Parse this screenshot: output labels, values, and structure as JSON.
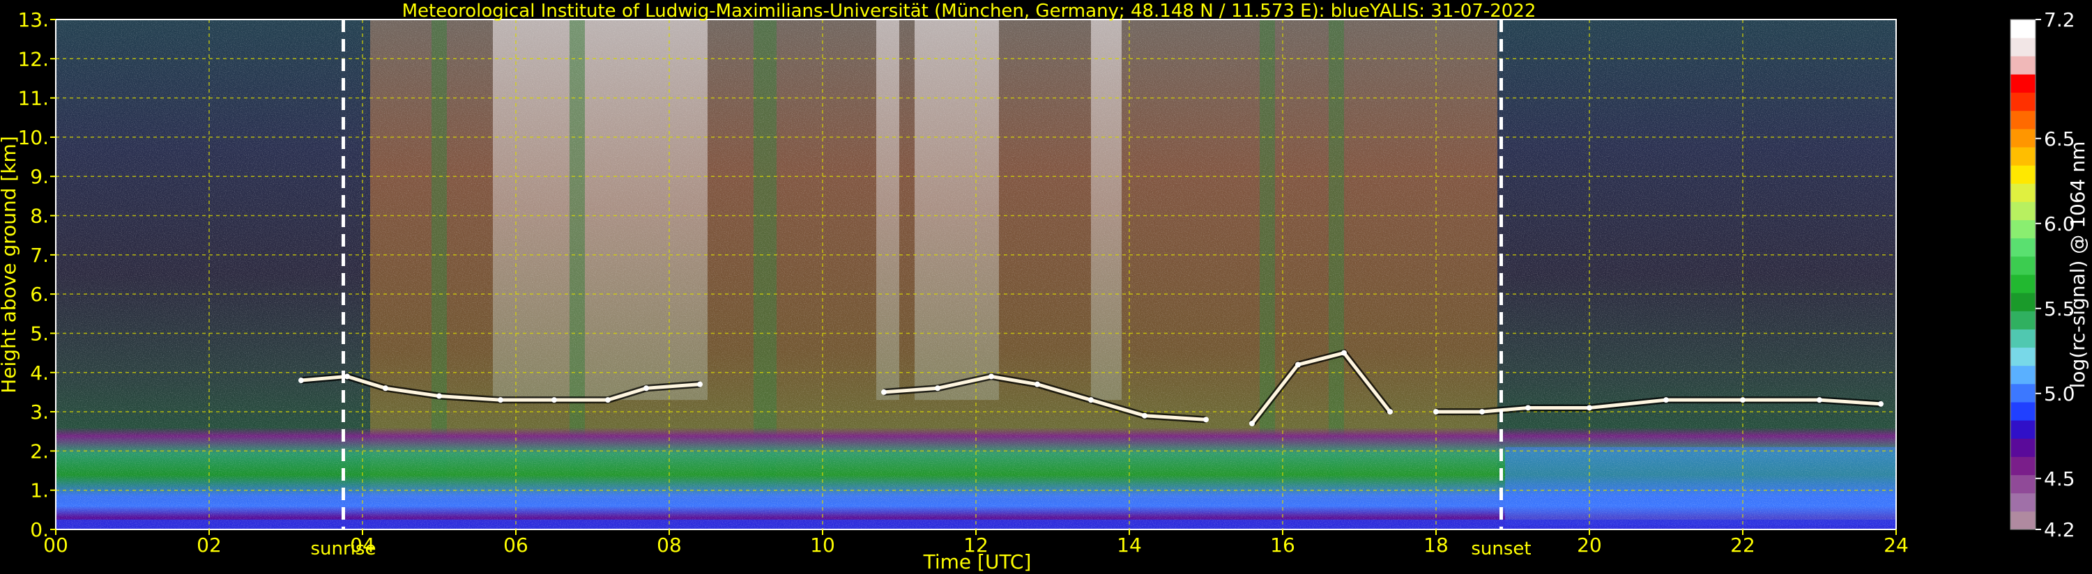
{
  "chart_data": {
    "type": "heatmap",
    "title": "Meteorological Institute of Ludwig-Maximilians-Universität (München, Germany; 48.148 N / 11.573 E):    blueYALIS: 31-07-2022",
    "xlabel": "Time [UTC]",
    "ylabel": "Height above ground [km]",
    "xlim": [
      0,
      24
    ],
    "ylim": [
      0,
      13
    ],
    "x_ticks": [
      "00",
      "02",
      "04",
      "06",
      "08",
      "10",
      "12",
      "14",
      "16",
      "18",
      "20",
      "22",
      "24"
    ],
    "y_ticks": [
      "0.",
      "1.",
      "2.",
      "3.",
      "4.",
      "5.",
      "6.",
      "7.",
      "8.",
      "9.",
      "10.",
      "11.",
      "12.",
      "13."
    ],
    "grid": true,
    "markers": [
      {
        "label": "sunrise",
        "time_utc": 3.75
      },
      {
        "label": "sunset",
        "time_utc": 18.85
      }
    ],
    "colorbar": {
      "label": "log(rc-signal) @ 1064 nm",
      "range": [
        4.2,
        7.2
      ],
      "tick_labels": [
        "7.2",
        "6.5",
        "6.0",
        "5.5",
        "5.0",
        "4.5",
        "4.2"
      ],
      "tick_values": [
        7.2,
        6.5,
        6.0,
        5.5,
        5.0,
        4.5,
        4.2
      ],
      "colors_bottom_to_top": [
        "#b08aa0",
        "#a070a8",
        "#904a98",
        "#7a1e8a",
        "#5a0a9a",
        "#3010c8",
        "#2040ff",
        "#3c78ff",
        "#5ab0ff",
        "#78d8e8",
        "#50c8b0",
        "#30b060",
        "#1a9a2a",
        "#22b830",
        "#3ccc50",
        "#5ae070",
        "#8aee70",
        "#b8f060",
        "#e0f040",
        "#ffe800",
        "#ffbe00",
        "#ff9600",
        "#ff6a00",
        "#ff3000",
        "#ff0000",
        "#f0b8b8",
        "#f2e6e6",
        "#ffffff"
      ]
    },
    "layers": [
      {
        "name": "boundary layer aerosol (green/cyan)",
        "height_km": [
          0.4,
          2.6
        ],
        "time_utc": [
          0,
          24
        ]
      },
      {
        "name": "near-surface enhanced layer (blue/white)",
        "height_km": [
          0.0,
          1.0
        ],
        "time_utc": [
          0,
          24
        ]
      },
      {
        "name": "cloud tops",
        "height_km": [
          2.4,
          4.6
        ],
        "time_utc": [
          3.0,
          23.8
        ]
      }
    ],
    "cloud_trace": [
      {
        "t": 3.2,
        "h": 3.8
      },
      {
        "t": 3.8,
        "h": 3.9
      },
      {
        "t": 4.3,
        "h": 3.6
      },
      {
        "t": 5.0,
        "h": 3.4
      },
      {
        "t": 5.8,
        "h": 3.3
      },
      {
        "t": 6.5,
        "h": 3.3
      },
      {
        "t": 7.2,
        "h": 3.3
      },
      {
        "t": 7.7,
        "h": 3.6
      },
      {
        "t": 8.4,
        "h": 3.7
      },
      {
        "t": 10.8,
        "h": 3.5
      },
      {
        "t": 11.5,
        "h": 3.6
      },
      {
        "t": 12.2,
        "h": 3.9
      },
      {
        "t": 12.8,
        "h": 3.7
      },
      {
        "t": 13.5,
        "h": 3.3
      },
      {
        "t": 14.2,
        "h": 2.9
      },
      {
        "t": 15.0,
        "h": 2.8
      },
      {
        "t": 15.6,
        "h": 2.7
      },
      {
        "t": 16.2,
        "h": 4.2
      },
      {
        "t": 16.8,
        "h": 4.5
      },
      {
        "t": 17.4,
        "h": 3.0
      },
      {
        "t": 18.0,
        "h": 3.0
      },
      {
        "t": 18.6,
        "h": 3.0
      },
      {
        "t": 19.2,
        "h": 3.1
      },
      {
        "t": 20.0,
        "h": 3.1
      },
      {
        "t": 21.0,
        "h": 3.3
      },
      {
        "t": 22.0,
        "h": 3.3
      },
      {
        "t": 23.0,
        "h": 3.3
      },
      {
        "t": 23.8,
        "h": 3.2
      }
    ]
  }
}
